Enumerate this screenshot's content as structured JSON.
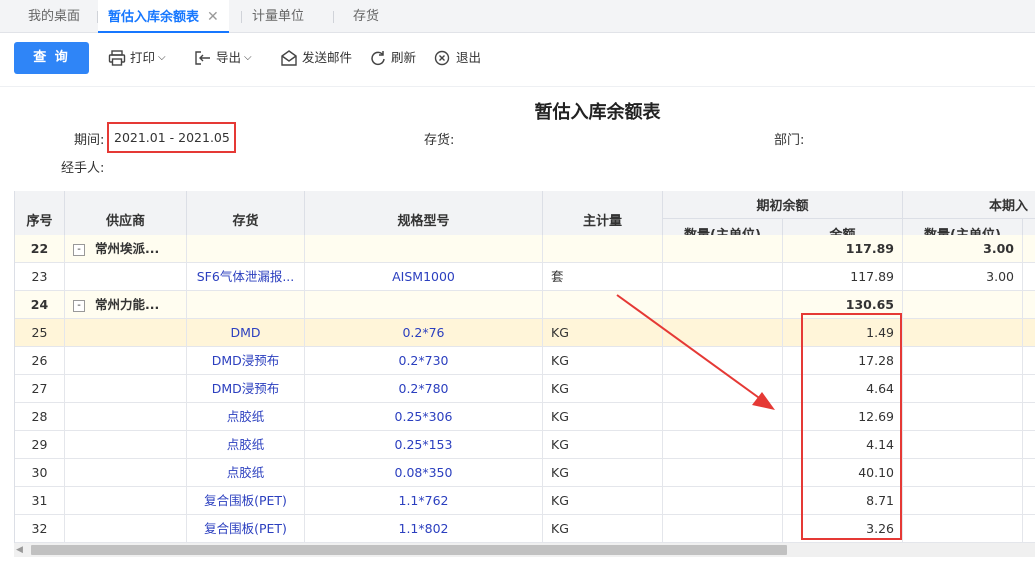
{
  "tabs": [
    {
      "label": "我的桌面"
    },
    {
      "label": "暂估入库余额表",
      "active": true,
      "close": "✕"
    },
    {
      "label": "计量单位"
    },
    {
      "label": "存货"
    }
  ],
  "toolbar": {
    "query_label": "查 询",
    "print_label": "打印",
    "export_label": "导出",
    "email_label": "发送邮件",
    "refresh_label": "刷新",
    "exit_label": "退出"
  },
  "report": {
    "title": "暂估入库余额表",
    "period_label": "期间:",
    "period_value": "2021.01 - 2021.05",
    "inventory_label": "存货:",
    "department_label": "部门:",
    "handler_label": "经手人:"
  },
  "table": {
    "headers": {
      "seq": "序号",
      "supplier": "供应商",
      "inventory": "存货",
      "spec": "规格型号",
      "unit": "主计量",
      "opening": "期初余额",
      "opening_qty": "数量(主单位)",
      "opening_amount": "金额",
      "current_in": "本期入",
      "current_qty": "数量(主单位)"
    },
    "rows": [
      {
        "seq": "22",
        "supplier": "常州埃派...",
        "inventory": "",
        "spec": "",
        "unit": "",
        "opening_qty": "",
        "amount": "117.89",
        "current_qty": "3.00",
        "group": true,
        "expander": "-"
      },
      {
        "seq": "23",
        "supplier": "",
        "inventory": "SF6气体泄漏报...",
        "spec": "AISM1000",
        "unit": "套",
        "opening_qty": "",
        "amount": "117.89",
        "current_qty": "3.00"
      },
      {
        "seq": "24",
        "supplier": "常州力能...",
        "inventory": "",
        "spec": "",
        "unit": "",
        "opening_qty": "",
        "amount": "130.65",
        "current_qty": "",
        "group": true,
        "expander": "-"
      },
      {
        "seq": "25",
        "supplier": "",
        "inventory": "DMD",
        "spec": "0.2*76",
        "unit": "KG",
        "opening_qty": "",
        "amount": "1.49",
        "current_qty": "",
        "selected": true
      },
      {
        "seq": "26",
        "supplier": "",
        "inventory": "DMD浸预布",
        "spec": "0.2*730",
        "unit": "KG",
        "opening_qty": "",
        "amount": "17.28",
        "current_qty": ""
      },
      {
        "seq": "27",
        "supplier": "",
        "inventory": "DMD浸预布",
        "spec": "0.2*780",
        "unit": "KG",
        "opening_qty": "",
        "amount": "4.64",
        "current_qty": ""
      },
      {
        "seq": "28",
        "supplier": "",
        "inventory": "点胶纸",
        "spec": "0.25*306",
        "unit": "KG",
        "opening_qty": "",
        "amount": "12.69",
        "current_qty": ""
      },
      {
        "seq": "29",
        "supplier": "",
        "inventory": "点胶纸",
        "spec": "0.25*153",
        "unit": "KG",
        "opening_qty": "",
        "amount": "4.14",
        "current_qty": ""
      },
      {
        "seq": "30",
        "supplier": "",
        "inventory": "点胶纸",
        "spec": "0.08*350",
        "unit": "KG",
        "opening_qty": "",
        "amount": "40.10",
        "current_qty": ""
      },
      {
        "seq": "31",
        "supplier": "",
        "inventory": "复合围板(PET)",
        "spec": "1.1*762",
        "unit": "KG",
        "opening_qty": "",
        "amount": "8.71",
        "current_qty": ""
      },
      {
        "seq": "32",
        "supplier": "",
        "inventory": "复合围板(PET)",
        "spec": "1.1*802",
        "unit": "KG",
        "opening_qty": "",
        "amount": "3.26",
        "current_qty": ""
      }
    ]
  },
  "icons": {
    "print": "printer-icon",
    "export": "export-icon",
    "email": "mail-icon",
    "refresh": "refresh-icon",
    "exit": "exit-icon"
  },
  "colors": {
    "accent": "#2f85f7",
    "annotation": "#e53935",
    "link_text": "#2b3fbf"
  }
}
